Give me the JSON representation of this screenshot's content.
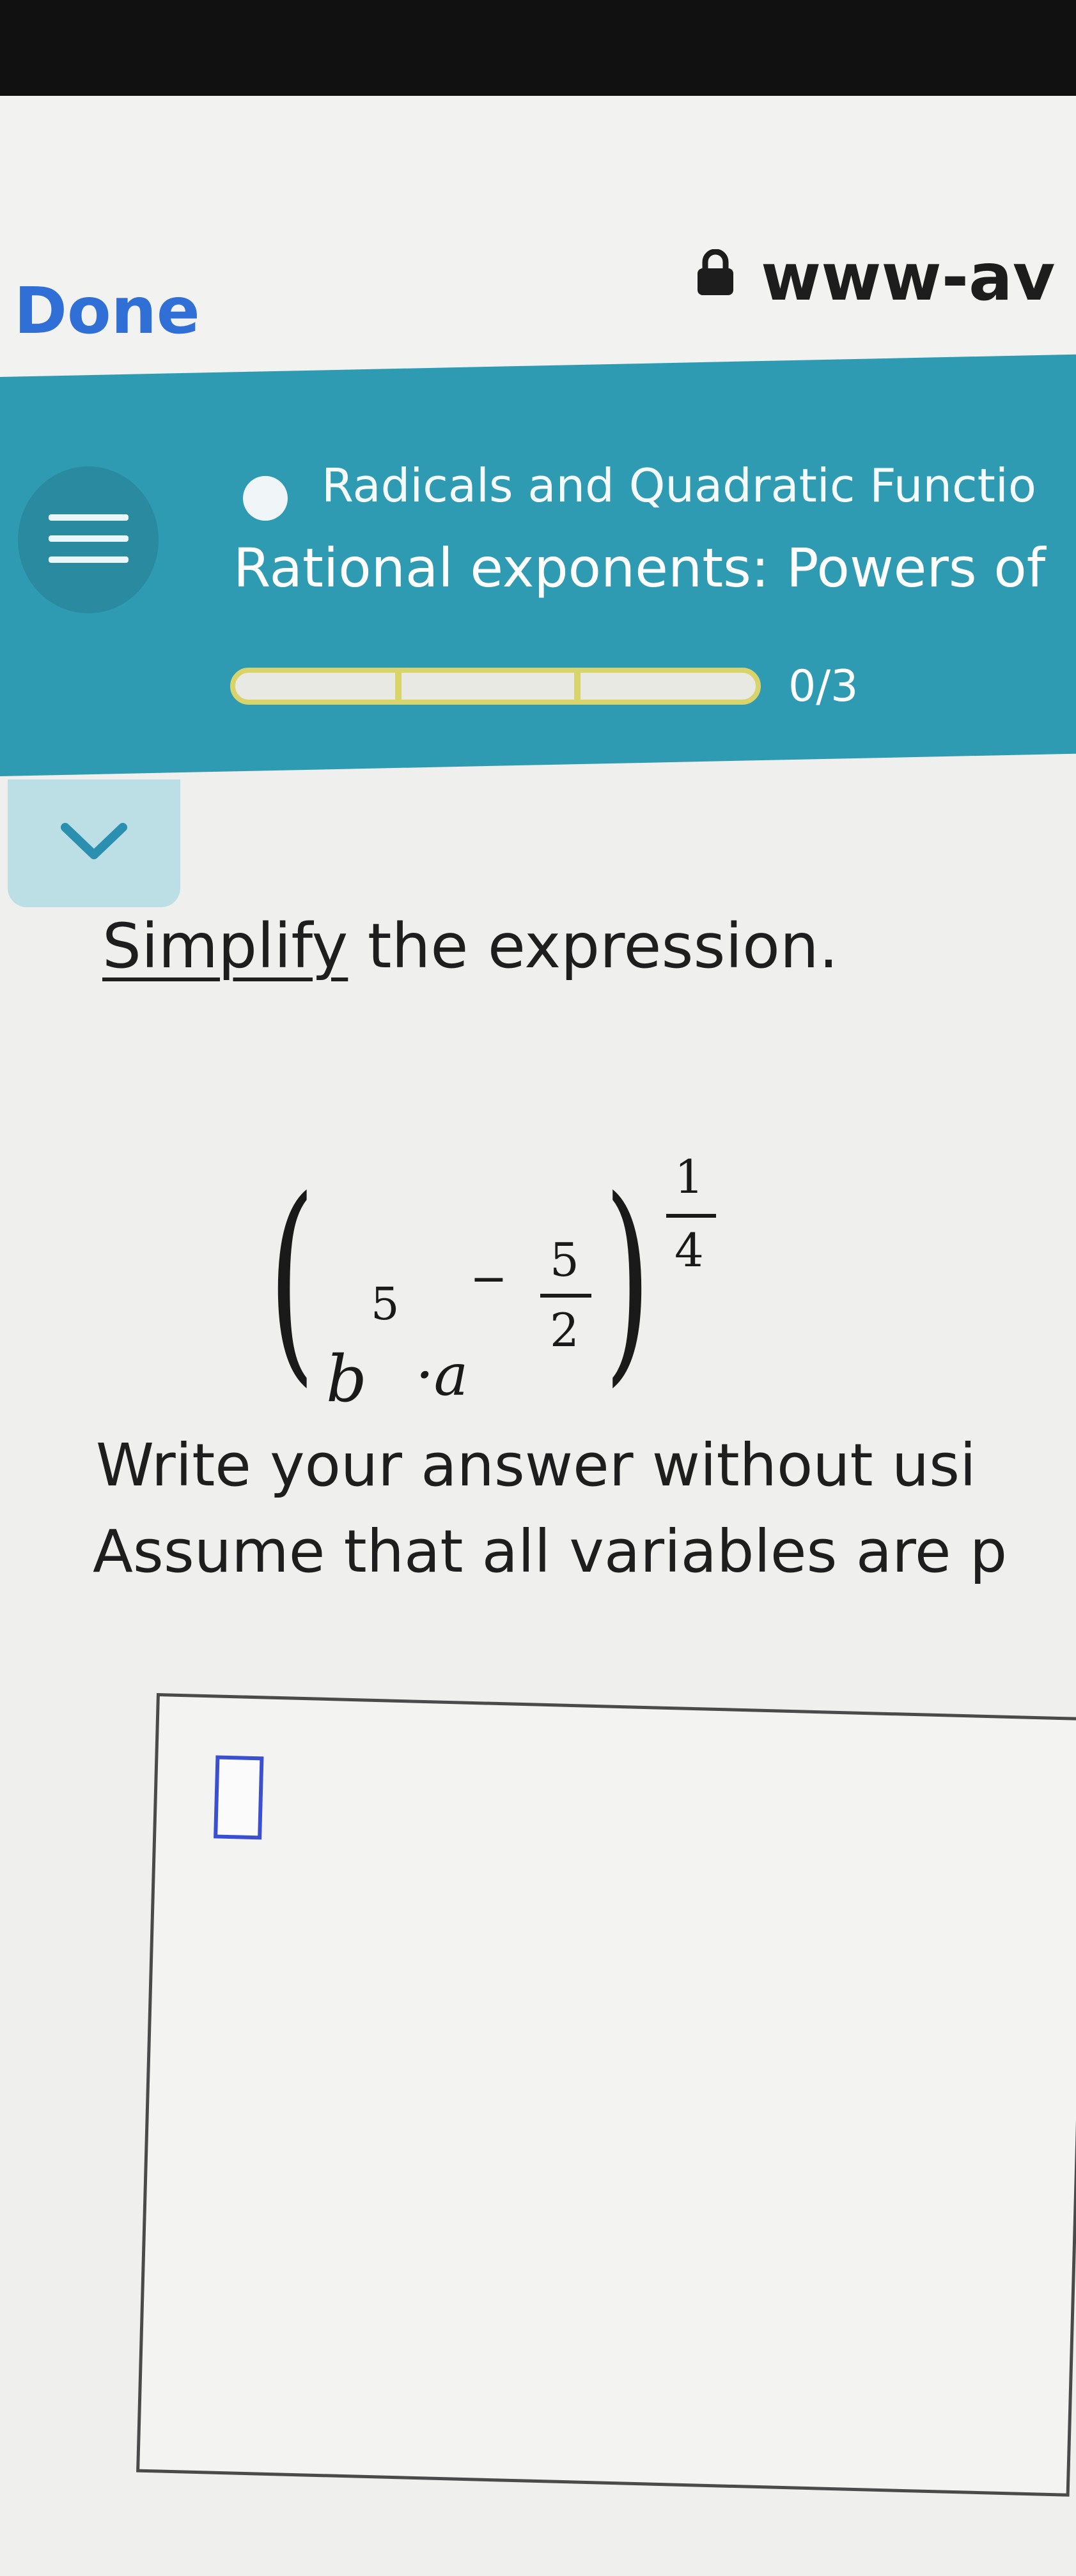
{
  "browser": {
    "done_label": "Done",
    "url_text": "www-av"
  },
  "header": {
    "topic": "Radicals and Quadratic Functio",
    "lesson": "Rational exponents: Powers of",
    "progress_text": "0/3",
    "progress": {
      "completed": 0,
      "total": 3
    },
    "accent_color": "#2f9bb3"
  },
  "problem": {
    "prompt_link": "Simplify",
    "prompt_rest": " the expression.",
    "expression": {
      "base": "b",
      "base_exponent": "5",
      "operator": "·",
      "variable": "a",
      "variable_exponent_sign": "−",
      "variable_exponent_num": "5",
      "variable_exponent_den": "2",
      "outer_exponent_num": "1",
      "outer_exponent_den": "4"
    },
    "instruction_line1": "Write your answer without usi",
    "instruction_line2": "Assume that all variables are p"
  },
  "icons": {
    "menu": "hamburger-icon",
    "lock": "lock-icon",
    "collapse": "chevron-down-icon"
  }
}
